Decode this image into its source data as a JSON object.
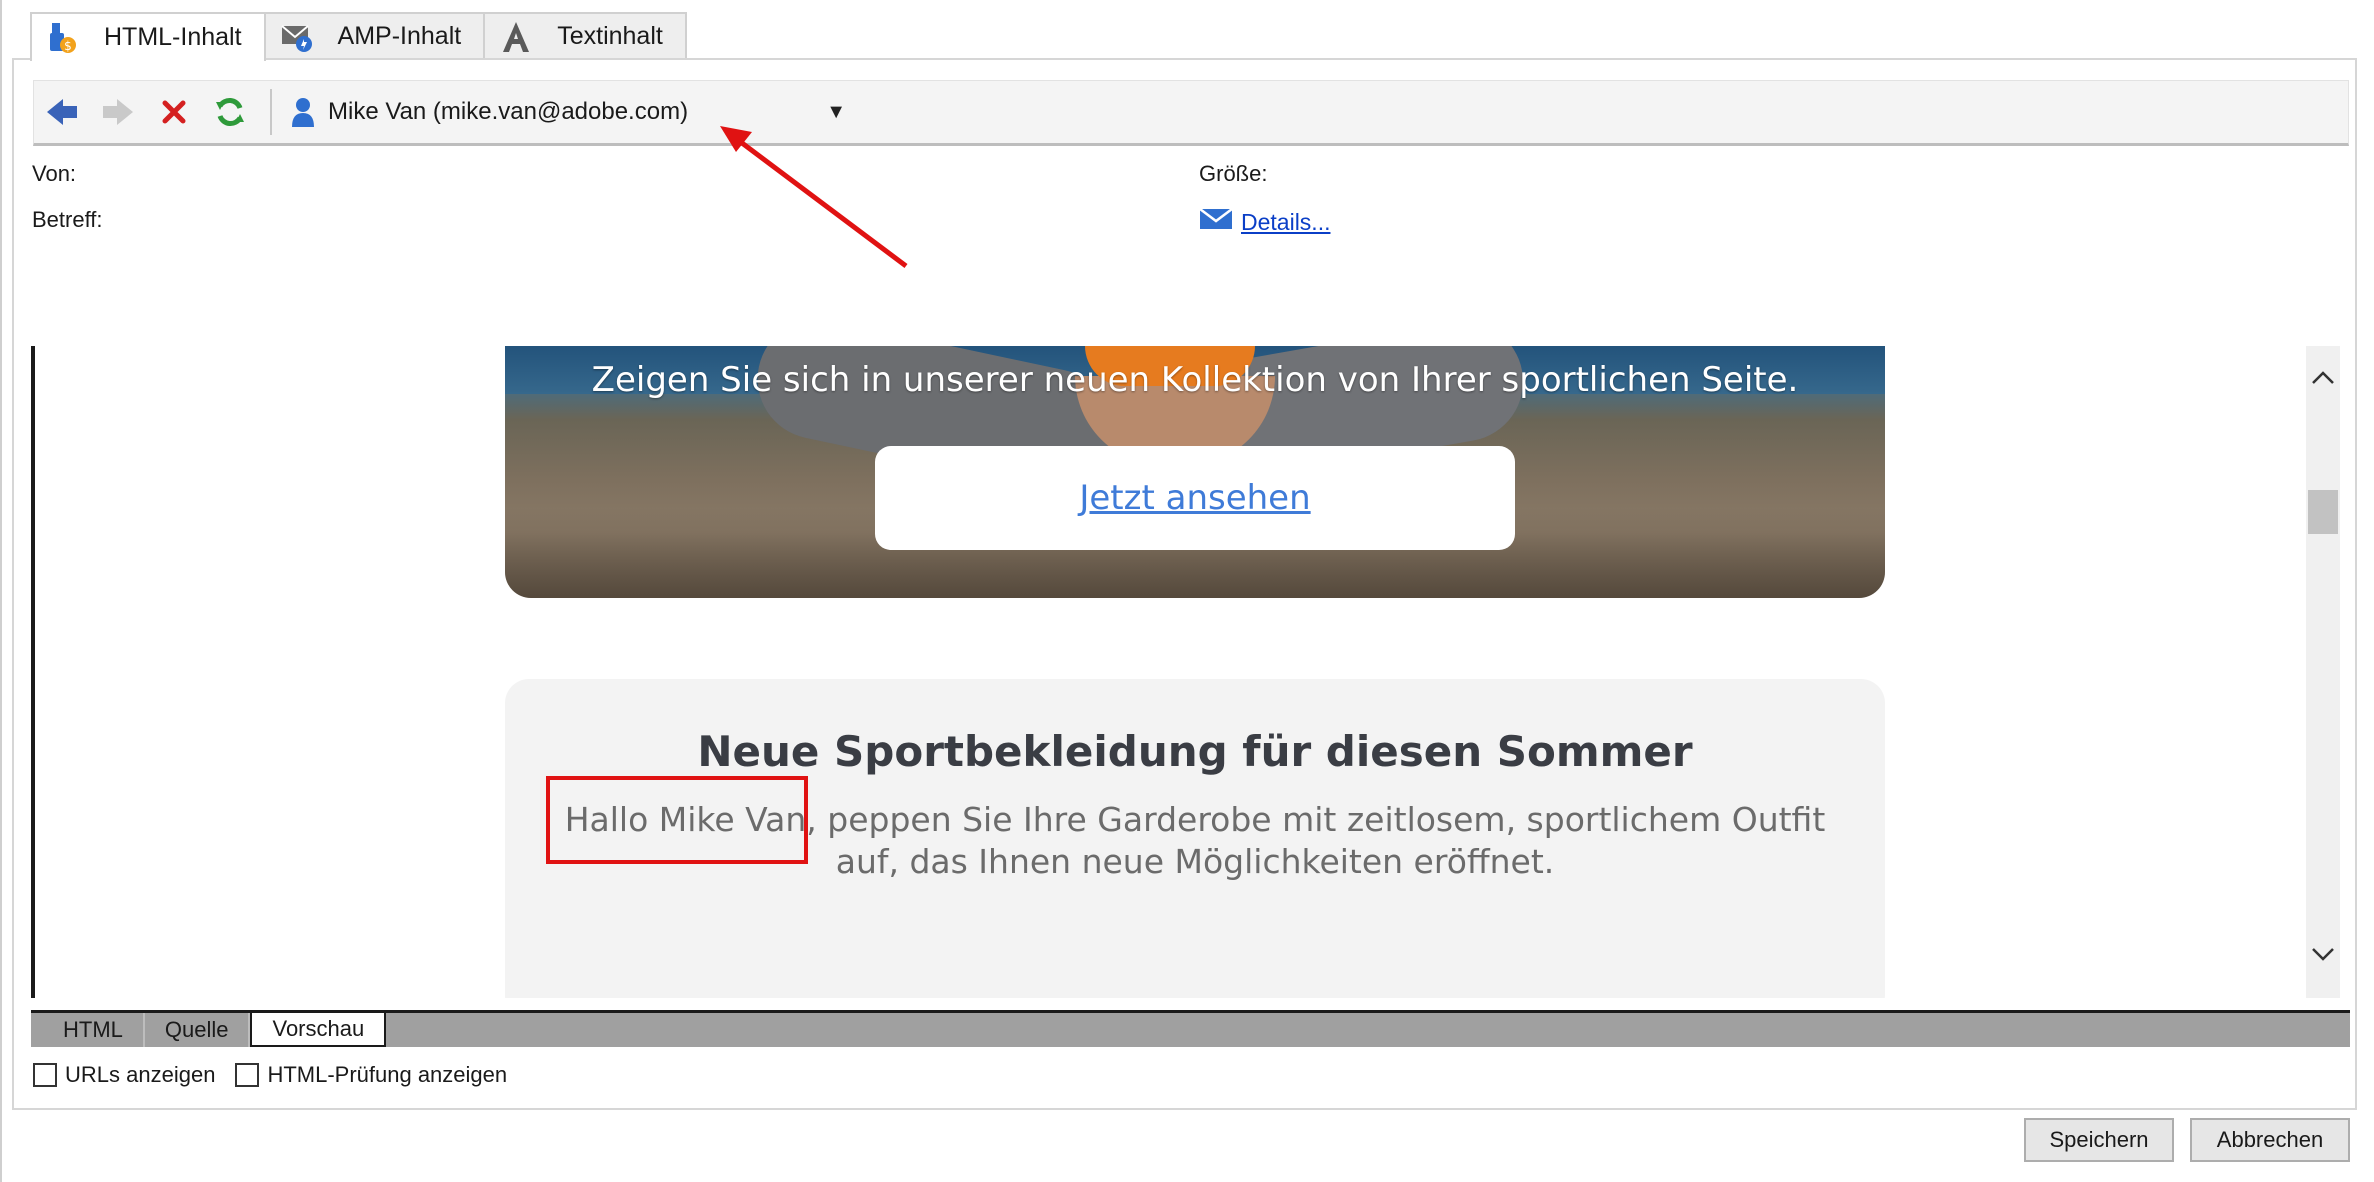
{
  "tabs": [
    {
      "label": "HTML-Inhalt",
      "icon": "html-content-icon",
      "active": true
    },
    {
      "label": "AMP-Inhalt",
      "icon": "amp-content-icon",
      "active": false
    },
    {
      "label": "Textinhalt",
      "icon": "text-content-icon",
      "active": false
    }
  ],
  "toolbar": {
    "back_icon": "back-arrow-icon",
    "forward_icon": "forward-arrow-icon",
    "delete_icon": "delete-icon",
    "refresh_icon": "refresh-icon",
    "recipient": "Mike Van (mike.van@adobe.com)"
  },
  "header": {
    "from_label": "Von:",
    "subject_label": "Betreff:",
    "size_label": "Größe:",
    "details_link": "Details..."
  },
  "preview": {
    "banner_headline": "Zeigen Sie sich in unserer neuen Kollektion von Ihrer sportlichen Seite.",
    "banner_cta": "Jetzt ansehen",
    "card_title": "Neue Sportbekleidung für diesen Sommer",
    "card_body": "Hallo Mike Van, peppen Sie Ihre Garderobe mit zeitlosem, sportlichem Outfit auf, das Ihnen neue Möglichkeiten eröffnet."
  },
  "view_tabs": [
    {
      "label": "HTML",
      "active": false
    },
    {
      "label": "Quelle",
      "active": false
    },
    {
      "label": "Vorschau",
      "active": true
    }
  ],
  "options": {
    "show_urls": "URLs anzeigen",
    "show_html_check": "HTML-Prüfung anzeigen"
  },
  "footer": {
    "save": "Speichern",
    "cancel": "Abbrechen"
  },
  "colors": {
    "link": "#0b3fc7",
    "cta_link": "#3f7bd8",
    "annotation": "#e01212",
    "delete": "#d42020",
    "refresh": "#2e9a3a"
  }
}
